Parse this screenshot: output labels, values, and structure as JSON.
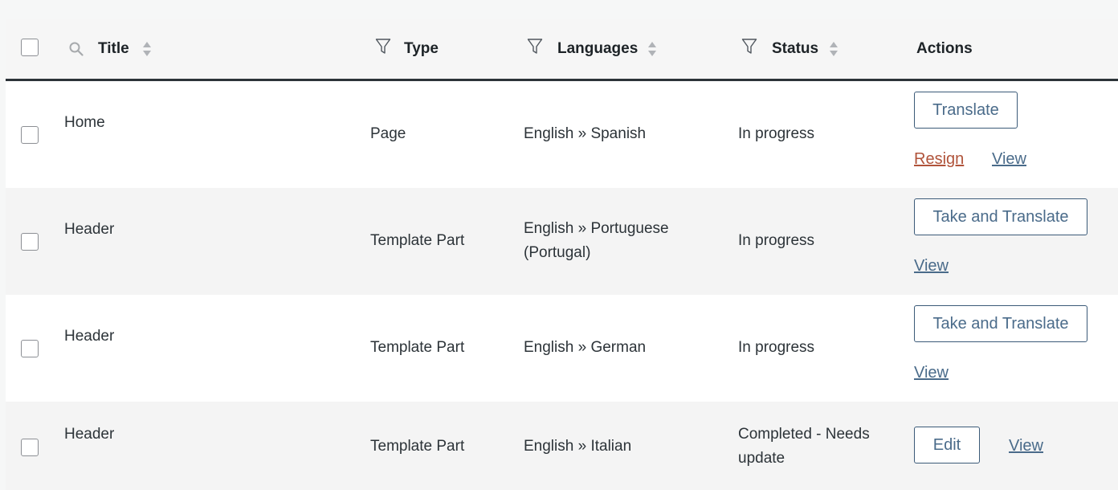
{
  "header": {
    "title": "Title",
    "type": "Type",
    "languages": "Languages",
    "status": "Status",
    "actions": "Actions",
    "icons": {
      "search": "search-icon",
      "filter": "filter-icon",
      "sort": "sort-icon"
    }
  },
  "rows": [
    {
      "title": "Home",
      "type": "Page",
      "languages_line1": "English » Spanish",
      "languages_line2": "",
      "status_line1": "In progress",
      "status_line2": "",
      "primary_action": "Translate",
      "secondary_action": "Resign",
      "view": "View"
    },
    {
      "title": "Header",
      "type": "Template Part",
      "languages_line1": "English » Portuguese",
      "languages_line2": "(Portugal)",
      "status_line1": "In progress",
      "status_line2": "",
      "primary_action": "Take and Translate",
      "view": "View"
    },
    {
      "title": "Header",
      "type": "Template Part",
      "languages_line1": "English » German",
      "languages_line2": "",
      "status_line1": "In progress",
      "status_line2": "",
      "primary_action": "Take and Translate",
      "view": "View"
    },
    {
      "title": "Header",
      "type": "Template Part",
      "languages_line1": "English » Italian",
      "languages_line2": "",
      "status_line1": "Completed - Needs",
      "status_line2": "update",
      "primary_action": "Edit",
      "view": "View"
    }
  ],
  "colors": {
    "link": "#4a6b8a",
    "danger_link": "#b0533a",
    "header_border": "#2c3338"
  }
}
